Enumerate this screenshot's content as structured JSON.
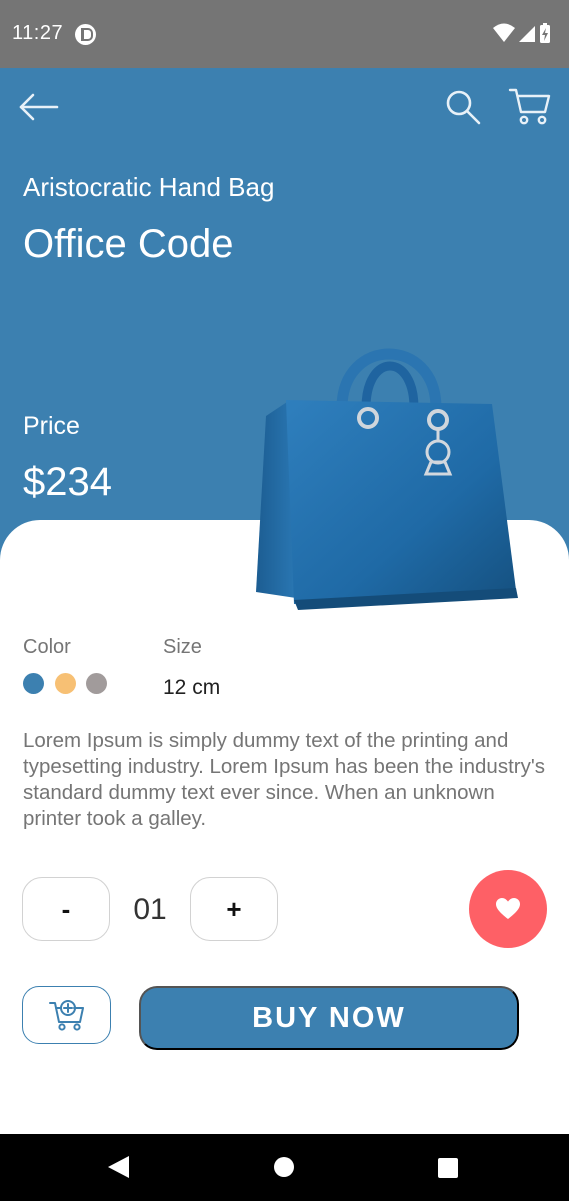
{
  "status_bar": {
    "time": "11:27",
    "icons": [
      "app-notification-icon",
      "wifi-icon",
      "signal-icon",
      "battery-icon"
    ]
  },
  "header": {
    "back_icon": "arrow-left-icon",
    "search_icon": "search-icon",
    "cart_icon": "cart-icon"
  },
  "product": {
    "subtitle": "Aristocratic Hand Bag",
    "title": "Office Code",
    "price_label": "Price",
    "price": "$234",
    "image": "blue-handbag"
  },
  "details": {
    "color_label": "Color",
    "colors": [
      "#3c80b0",
      "#f7c074",
      "#a19b9b"
    ],
    "size_label": "Size",
    "size_value": "12 cm",
    "description": "Lorem Ipsum is simply dummy text of the printing and typesetting industry. Lorem Ipsum has been the industry's standard dummy text ever since. When an unknown printer took a galley."
  },
  "quantity": {
    "minus_label": "-",
    "value": "01",
    "plus_label": "+"
  },
  "actions": {
    "favorite_icon": "heart-icon",
    "add_to_cart_icon": "cart-add-icon",
    "buy_label": "BUY NOW"
  },
  "theme": {
    "accent": "#3c80b0",
    "favorite": "#fe6066"
  },
  "nav_bar": {
    "icons": [
      "nav-back-icon",
      "nav-home-icon",
      "nav-recents-icon"
    ]
  }
}
